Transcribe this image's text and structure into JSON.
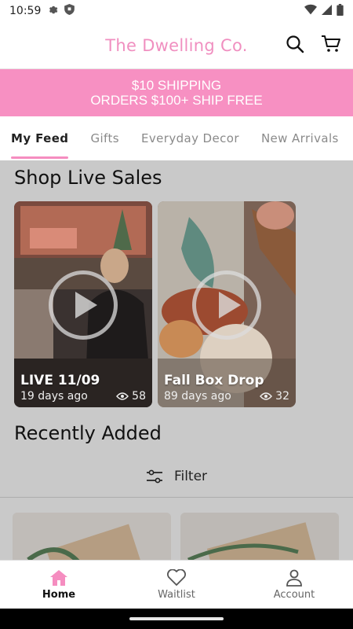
{
  "status_bar": {
    "time": "10:59"
  },
  "header": {
    "brand": "The Dwelling Co."
  },
  "promo": {
    "line1": "$10 SHIPPING",
    "line2": "ORDERS $100+  SHIP FREE"
  },
  "tabs": [
    {
      "label": "My Feed",
      "active": true
    },
    {
      "label": "Gifts"
    },
    {
      "label": "Everyday Decor"
    },
    {
      "label": "New Arrivals"
    }
  ],
  "live_sales": {
    "title": "Shop Live Sales",
    "cards": [
      {
        "title": "LIVE 11/09",
        "age": "19 days ago",
        "views": "58"
      },
      {
        "title": "Fall Box Drop",
        "age": "89 days ago",
        "views": "32"
      }
    ]
  },
  "recently_added": {
    "title": "Recently Added",
    "filter_label": "Filter"
  },
  "bottom_nav": [
    {
      "label": "Home",
      "active": true
    },
    {
      "label": "Waitlist"
    },
    {
      "label": "Account"
    }
  ],
  "colors": {
    "brand_pink": "#f08fc0",
    "banner_pink": "#f790c2",
    "overlay_gray": "#c9c9c9"
  }
}
